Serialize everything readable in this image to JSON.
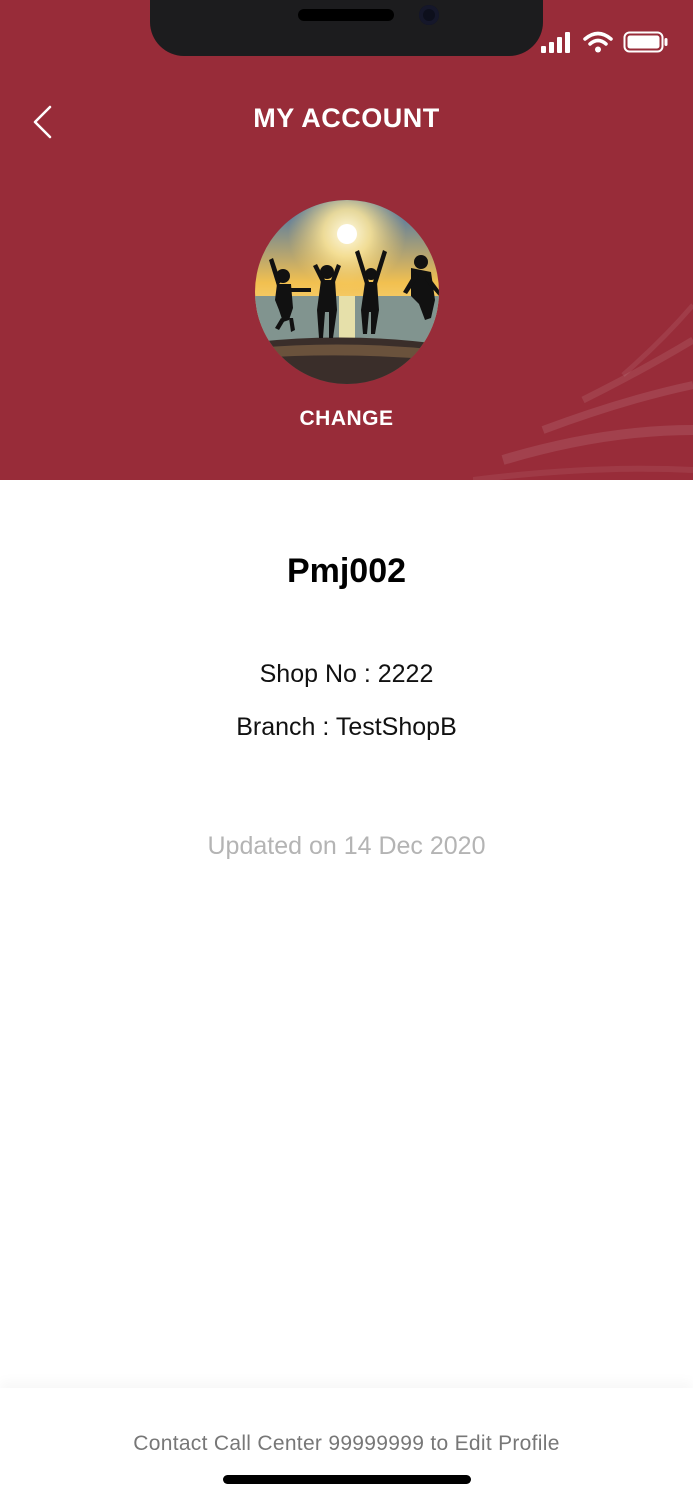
{
  "header": {
    "title": "MY ACCOUNT",
    "back_icon": "chevron-left-icon",
    "change_label": "CHANGE",
    "background_color": "#982c39"
  },
  "status_bar": {
    "icons": [
      "signal-icon",
      "wifi-icon",
      "battery-icon"
    ]
  },
  "profile": {
    "username": "Pmj002",
    "shop_no": "Shop No : 2222",
    "branch": "Branch : TestShopB",
    "updated": "Updated on 14 Dec 2020"
  },
  "footer": {
    "message": "Contact Call Center 99999999 to Edit Profile"
  }
}
